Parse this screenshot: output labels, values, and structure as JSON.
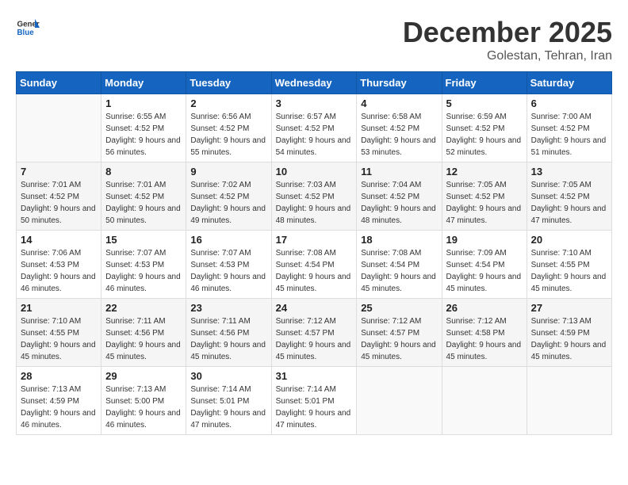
{
  "header": {
    "logo_general": "General",
    "logo_blue": "Blue",
    "month_title": "December 2025",
    "location": "Golestan, Tehran, Iran"
  },
  "days_of_week": [
    "Sunday",
    "Monday",
    "Tuesday",
    "Wednesday",
    "Thursday",
    "Friday",
    "Saturday"
  ],
  "weeks": [
    [
      {
        "day": "",
        "sunrise": "",
        "sunset": "",
        "daylight": ""
      },
      {
        "day": "1",
        "sunrise": "Sunrise: 6:55 AM",
        "sunset": "Sunset: 4:52 PM",
        "daylight": "Daylight: 9 hours and 56 minutes."
      },
      {
        "day": "2",
        "sunrise": "Sunrise: 6:56 AM",
        "sunset": "Sunset: 4:52 PM",
        "daylight": "Daylight: 9 hours and 55 minutes."
      },
      {
        "day": "3",
        "sunrise": "Sunrise: 6:57 AM",
        "sunset": "Sunset: 4:52 PM",
        "daylight": "Daylight: 9 hours and 54 minutes."
      },
      {
        "day": "4",
        "sunrise": "Sunrise: 6:58 AM",
        "sunset": "Sunset: 4:52 PM",
        "daylight": "Daylight: 9 hours and 53 minutes."
      },
      {
        "day": "5",
        "sunrise": "Sunrise: 6:59 AM",
        "sunset": "Sunset: 4:52 PM",
        "daylight": "Daylight: 9 hours and 52 minutes."
      },
      {
        "day": "6",
        "sunrise": "Sunrise: 7:00 AM",
        "sunset": "Sunset: 4:52 PM",
        "daylight": "Daylight: 9 hours and 51 minutes."
      }
    ],
    [
      {
        "day": "7",
        "sunrise": "Sunrise: 7:01 AM",
        "sunset": "Sunset: 4:52 PM",
        "daylight": "Daylight: 9 hours and 50 minutes."
      },
      {
        "day": "8",
        "sunrise": "Sunrise: 7:01 AM",
        "sunset": "Sunset: 4:52 PM",
        "daylight": "Daylight: 9 hours and 50 minutes."
      },
      {
        "day": "9",
        "sunrise": "Sunrise: 7:02 AM",
        "sunset": "Sunset: 4:52 PM",
        "daylight": "Daylight: 9 hours and 49 minutes."
      },
      {
        "day": "10",
        "sunrise": "Sunrise: 7:03 AM",
        "sunset": "Sunset: 4:52 PM",
        "daylight": "Daylight: 9 hours and 48 minutes."
      },
      {
        "day": "11",
        "sunrise": "Sunrise: 7:04 AM",
        "sunset": "Sunset: 4:52 PM",
        "daylight": "Daylight: 9 hours and 48 minutes."
      },
      {
        "day": "12",
        "sunrise": "Sunrise: 7:05 AM",
        "sunset": "Sunset: 4:52 PM",
        "daylight": "Daylight: 9 hours and 47 minutes."
      },
      {
        "day": "13",
        "sunrise": "Sunrise: 7:05 AM",
        "sunset": "Sunset: 4:52 PM",
        "daylight": "Daylight: 9 hours and 47 minutes."
      }
    ],
    [
      {
        "day": "14",
        "sunrise": "Sunrise: 7:06 AM",
        "sunset": "Sunset: 4:53 PM",
        "daylight": "Daylight: 9 hours and 46 minutes."
      },
      {
        "day": "15",
        "sunrise": "Sunrise: 7:07 AM",
        "sunset": "Sunset: 4:53 PM",
        "daylight": "Daylight: 9 hours and 46 minutes."
      },
      {
        "day": "16",
        "sunrise": "Sunrise: 7:07 AM",
        "sunset": "Sunset: 4:53 PM",
        "daylight": "Daylight: 9 hours and 46 minutes."
      },
      {
        "day": "17",
        "sunrise": "Sunrise: 7:08 AM",
        "sunset": "Sunset: 4:54 PM",
        "daylight": "Daylight: 9 hours and 45 minutes."
      },
      {
        "day": "18",
        "sunrise": "Sunrise: 7:08 AM",
        "sunset": "Sunset: 4:54 PM",
        "daylight": "Daylight: 9 hours and 45 minutes."
      },
      {
        "day": "19",
        "sunrise": "Sunrise: 7:09 AM",
        "sunset": "Sunset: 4:54 PM",
        "daylight": "Daylight: 9 hours and 45 minutes."
      },
      {
        "day": "20",
        "sunrise": "Sunrise: 7:10 AM",
        "sunset": "Sunset: 4:55 PM",
        "daylight": "Daylight: 9 hours and 45 minutes."
      }
    ],
    [
      {
        "day": "21",
        "sunrise": "Sunrise: 7:10 AM",
        "sunset": "Sunset: 4:55 PM",
        "daylight": "Daylight: 9 hours and 45 minutes."
      },
      {
        "day": "22",
        "sunrise": "Sunrise: 7:11 AM",
        "sunset": "Sunset: 4:56 PM",
        "daylight": "Daylight: 9 hours and 45 minutes."
      },
      {
        "day": "23",
        "sunrise": "Sunrise: 7:11 AM",
        "sunset": "Sunset: 4:56 PM",
        "daylight": "Daylight: 9 hours and 45 minutes."
      },
      {
        "day": "24",
        "sunrise": "Sunrise: 7:12 AM",
        "sunset": "Sunset: 4:57 PM",
        "daylight": "Daylight: 9 hours and 45 minutes."
      },
      {
        "day": "25",
        "sunrise": "Sunrise: 7:12 AM",
        "sunset": "Sunset: 4:57 PM",
        "daylight": "Daylight: 9 hours and 45 minutes."
      },
      {
        "day": "26",
        "sunrise": "Sunrise: 7:12 AM",
        "sunset": "Sunset: 4:58 PM",
        "daylight": "Daylight: 9 hours and 45 minutes."
      },
      {
        "day": "27",
        "sunrise": "Sunrise: 7:13 AM",
        "sunset": "Sunset: 4:59 PM",
        "daylight": "Daylight: 9 hours and 45 minutes."
      }
    ],
    [
      {
        "day": "28",
        "sunrise": "Sunrise: 7:13 AM",
        "sunset": "Sunset: 4:59 PM",
        "daylight": "Daylight: 9 hours and 46 minutes."
      },
      {
        "day": "29",
        "sunrise": "Sunrise: 7:13 AM",
        "sunset": "Sunset: 5:00 PM",
        "daylight": "Daylight: 9 hours and 46 minutes."
      },
      {
        "day": "30",
        "sunrise": "Sunrise: 7:14 AM",
        "sunset": "Sunset: 5:01 PM",
        "daylight": "Daylight: 9 hours and 47 minutes."
      },
      {
        "day": "31",
        "sunrise": "Sunrise: 7:14 AM",
        "sunset": "Sunset: 5:01 PM",
        "daylight": "Daylight: 9 hours and 47 minutes."
      },
      {
        "day": "",
        "sunrise": "",
        "sunset": "",
        "daylight": ""
      },
      {
        "day": "",
        "sunrise": "",
        "sunset": "",
        "daylight": ""
      },
      {
        "day": "",
        "sunrise": "",
        "sunset": "",
        "daylight": ""
      }
    ]
  ]
}
